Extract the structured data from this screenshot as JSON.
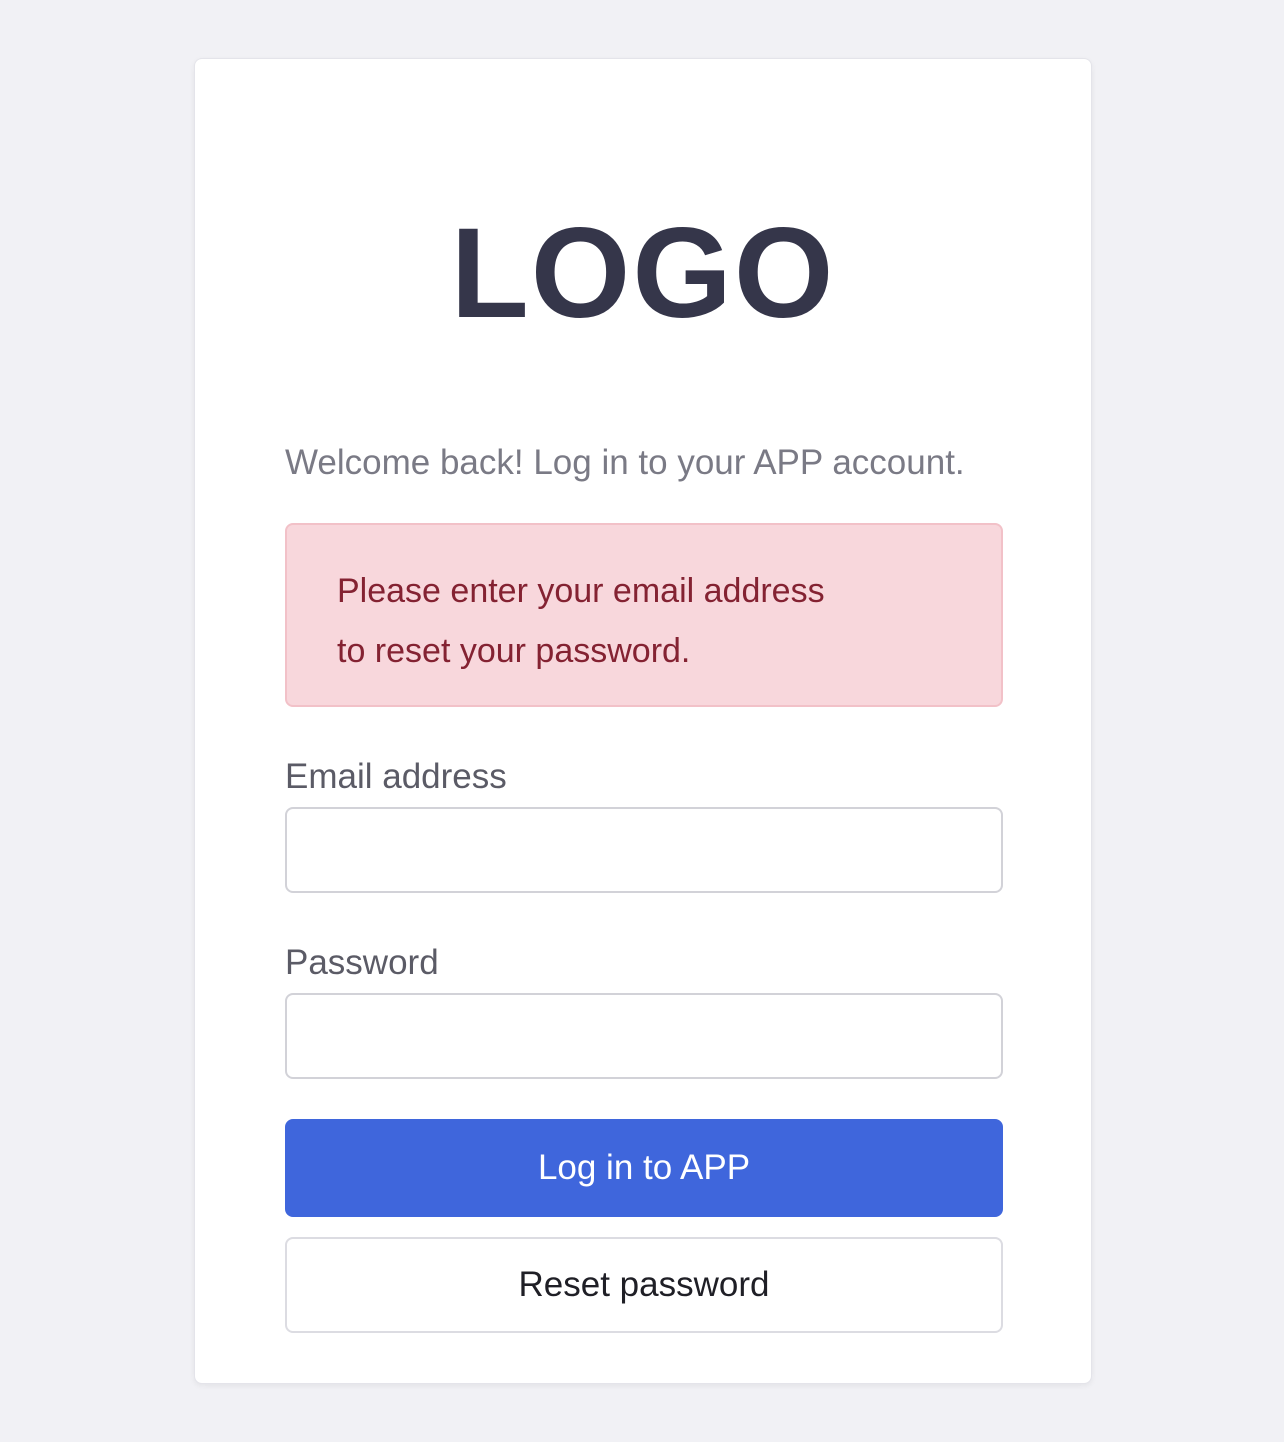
{
  "brand": {
    "logo_text": "LOGO"
  },
  "intro": {
    "welcome": "Welcome back! Log in to your APP account."
  },
  "alert": {
    "line1": "Please enter your email address",
    "line2": "to reset your password."
  },
  "form": {
    "email_label": "Email address",
    "email_value": "",
    "password_label": "Password",
    "password_value": ""
  },
  "actions": {
    "login_label": "Log in to APP",
    "reset_label": "Reset password"
  },
  "colors": {
    "primary": "#3f66dc",
    "alert_bg": "#f8d7dc",
    "alert_text": "#842232",
    "logo": "#35364a"
  }
}
